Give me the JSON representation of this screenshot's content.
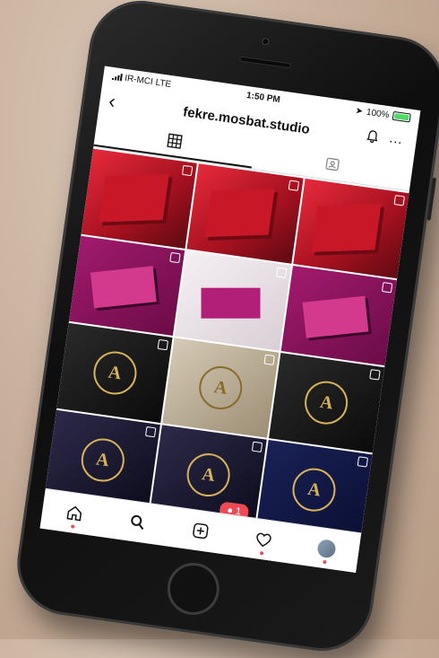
{
  "status": {
    "carrier": "IR-MCI",
    "network": "LTE",
    "time": "1:50 PM",
    "battery_text": "100%",
    "battery_level": 1.0
  },
  "header": {
    "back_icon": "back-arrow-icon",
    "username": "fekre.mosbat.studio",
    "bell_icon": "bell-icon",
    "more_icon": "more-icon",
    "more_glyph": "···"
  },
  "tabs": [
    {
      "name": "grid-icon",
      "active": true
    },
    {
      "name": "tagged-icon",
      "active": false
    }
  ],
  "posts": [
    {
      "theme": "red"
    },
    {
      "theme": "red"
    },
    {
      "theme": "red"
    },
    {
      "theme": "purple"
    },
    {
      "theme": "white"
    },
    {
      "theme": "purple"
    },
    {
      "theme": "dark",
      "crest": "A"
    },
    {
      "theme": "gold",
      "crest": "A"
    },
    {
      "theme": "dark",
      "crest": "A"
    },
    {
      "theme": "night",
      "crest": "A"
    },
    {
      "theme": "night",
      "crest": "A"
    },
    {
      "theme": "navy",
      "crest": "A"
    }
  ],
  "notification": {
    "icon": "person-icon",
    "count": "1"
  },
  "navbar": [
    {
      "name": "home-icon"
    },
    {
      "name": "search-icon"
    },
    {
      "name": "add-post-icon"
    },
    {
      "name": "heart-icon"
    },
    {
      "name": "profile-avatar"
    }
  ],
  "colors": {
    "accent": "#ed4956",
    "battery": "#4cd964"
  }
}
